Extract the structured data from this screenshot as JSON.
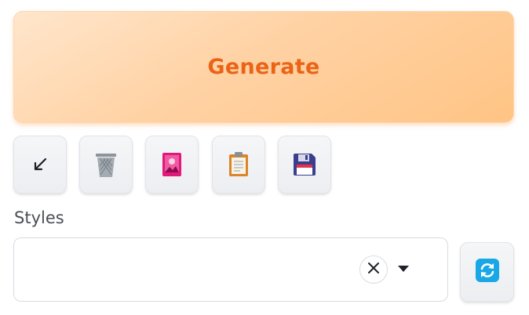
{
  "generate": {
    "label": "Generate"
  },
  "toolbar": {
    "buttons": [
      {
        "icon": "arrow-down-left-icon"
      },
      {
        "icon": "trash-icon"
      },
      {
        "icon": "image-icon"
      },
      {
        "icon": "clipboard-icon"
      },
      {
        "icon": "floppy-disk-icon"
      }
    ]
  },
  "styles": {
    "label": "Styles",
    "selected_value": "",
    "clear_icon": "close-icon",
    "dropdown_icon": "caret-down-icon",
    "refresh_icon": "refresh-icon"
  },
  "colors": {
    "generate_text": "#ea6417",
    "generate_bg": "#ffc485",
    "image_icon": "#e2187b",
    "refresh_icon": "#1aa7e6",
    "floppy_icon": "#3b3e8f"
  }
}
